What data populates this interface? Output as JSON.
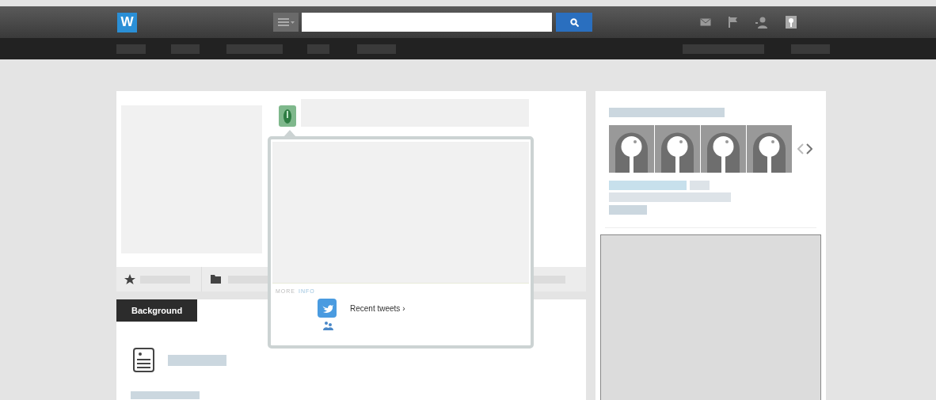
{
  "topbar": {
    "logo": "W"
  },
  "popover": {
    "section_label": [
      {
        "text": "MORE",
        "kind": "plain"
      },
      {
        "text": "INFO",
        "kind": "accent"
      }
    ],
    "links": [
      {
        "kind": "twitter",
        "label": "Recent tweets ›"
      },
      {
        "kind": "people"
      }
    ]
  },
  "profile": {
    "tabs": [
      {
        "label": "Background",
        "selected": true
      }
    ]
  }
}
